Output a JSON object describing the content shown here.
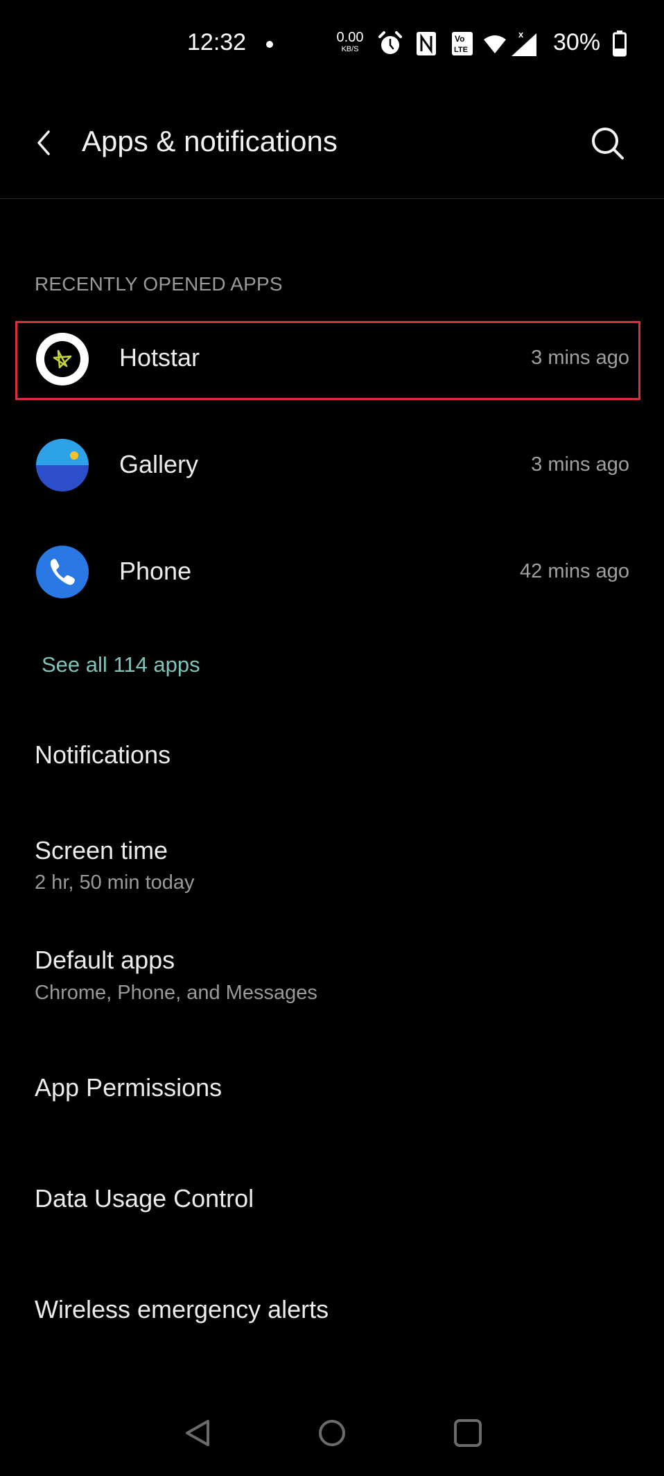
{
  "status_bar": {
    "time": "12:32",
    "net_speed_value": "0.00",
    "net_speed_unit": "KB/S",
    "battery_percent": "30%",
    "icons": [
      "notification-dot",
      "alarm-icon",
      "nfc-icon",
      "volte-icon",
      "wifi-icon",
      "cell-signal-icon",
      "battery-icon"
    ]
  },
  "header": {
    "title": "Apps & notifications",
    "back_icon": "chevron-left-icon",
    "search_icon": "search-icon"
  },
  "recent": {
    "section_label": "RECENTLY OPENED APPS",
    "apps": [
      {
        "name": "Hotstar",
        "time": "3 mins ago",
        "icon": "hotstar-icon",
        "highlighted": true
      },
      {
        "name": "Gallery",
        "time": "3 mins ago",
        "icon": "gallery-icon"
      },
      {
        "name": "Phone",
        "time": "42 mins ago",
        "icon": "phone-icon"
      }
    ],
    "see_all": "See all 114 apps"
  },
  "preferences": [
    {
      "title": "Notifications"
    },
    {
      "title": "Screen time",
      "subtitle": "2 hr, 50 min today"
    },
    {
      "title": "Default apps",
      "subtitle": "Chrome, Phone, and Messages"
    },
    {
      "title": "App Permissions"
    },
    {
      "title": "Data Usage Control"
    },
    {
      "title": "Wireless emergency alerts"
    }
  ],
  "nav_bar": {
    "buttons": [
      "back",
      "home",
      "recents"
    ]
  },
  "colors": {
    "background": "#000000",
    "highlight_border": "#d9303c",
    "link": "#7fc4bb"
  }
}
